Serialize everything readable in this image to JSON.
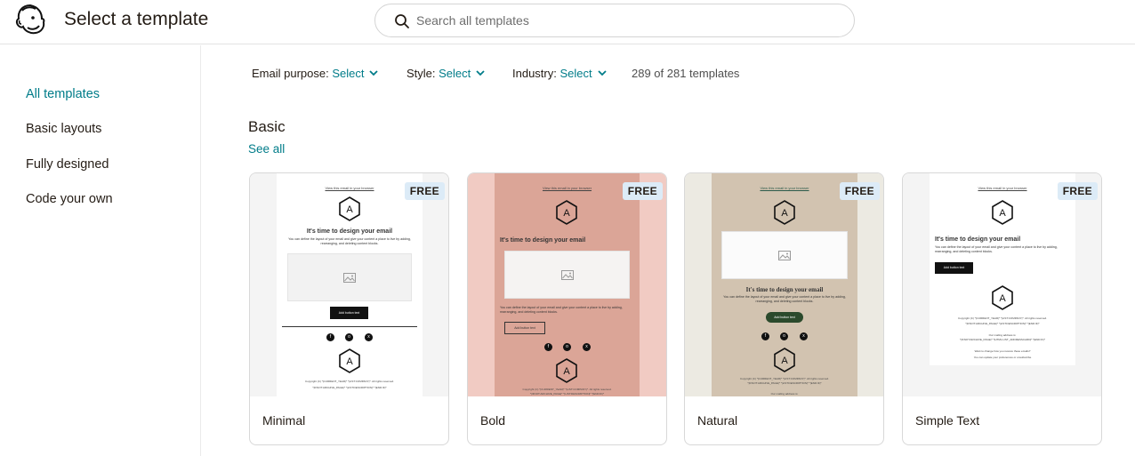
{
  "header": {
    "title": "Select a template",
    "search_placeholder": "Search all templates"
  },
  "sidebar": {
    "items": [
      {
        "label": "All templates",
        "active": true
      },
      {
        "label": "Basic layouts",
        "active": false
      },
      {
        "label": "Fully designed",
        "active": false
      },
      {
        "label": "Code your own",
        "active": false
      }
    ]
  },
  "filters": {
    "purpose_label": "Email purpose:",
    "purpose_value": "Select",
    "style_label": "Style:",
    "style_value": "Select",
    "industry_label": "Industry:",
    "industry_value": "Select",
    "count": "289 of 281 templates"
  },
  "section": {
    "title": "Basic",
    "see_all": "See all"
  },
  "templates": [
    {
      "name": "Minimal",
      "badge": "FREE"
    },
    {
      "name": "Bold",
      "badge": "FREE"
    },
    {
      "name": "Natural",
      "badge": "FREE"
    },
    {
      "name": "Simple Text",
      "badge": "FREE"
    }
  ],
  "preview": {
    "view_link": "View this email in your browser",
    "hex_letter": "A",
    "headline": "It's time to design your email",
    "body": "You can define the layout of your email and give your content a place to live by adding, rearranging, and deleting content blocks.",
    "button": "Add button text",
    "copyright": "Copyright (C) *|CURRENT_YEAR|* *|LIST:COMPANY|*. All rights reserved.",
    "desc": "*|IFNOT:ARCHIVE_PAGE|* *|LIST:DESCRIPTION|* *|END:IF|*",
    "mailing": "Our mailing address is:",
    "address": "*|IFNOT:ARCHIVE_PAGE|* *|HTML:LIST_ADDRESSCARD|* *|END:IF|*",
    "change": "Want to change how you receive these emails?",
    "prefs": "You can update your preferences or unsubscribe",
    "social": [
      "f",
      "o",
      "x"
    ]
  },
  "colors": {
    "accent": "#007c89",
    "bold_outer": "#f1cbc3",
    "bold_inner": "#dba597",
    "natural_outer": "#eceae2",
    "natural_inner": "#d2c3b0",
    "natural_button": "#2b4a2c",
    "badge_bg": "#dcebf7"
  }
}
